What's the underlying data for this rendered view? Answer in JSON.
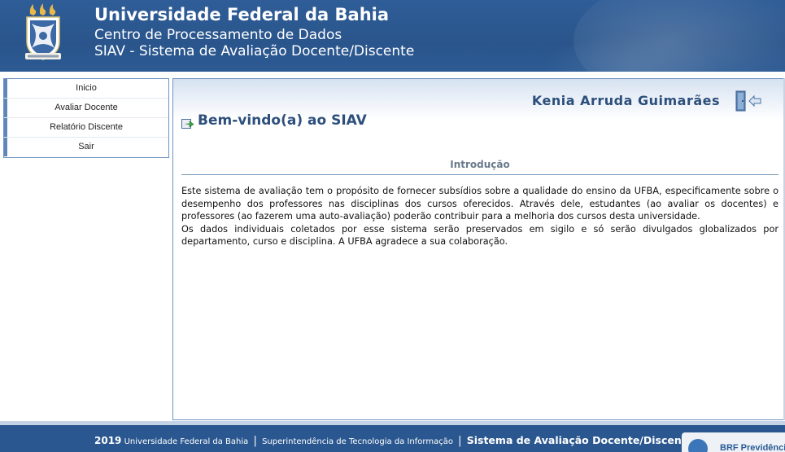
{
  "header": {
    "title": "Universidade Federal da Bahia",
    "subtitle": "Centro de Processamento de Dados",
    "system": "SIAV - Sistema de Avaliação Docente/Discente"
  },
  "menu": {
    "items": [
      {
        "label": "Inicio"
      },
      {
        "label": "Avaliar Docente"
      },
      {
        "label": "Relatório Discente"
      },
      {
        "label": "Sair"
      }
    ]
  },
  "main": {
    "user_name": "Kenia Arruda Guimarães",
    "welcome": "Bem-vindo(a) ao SIAV",
    "section_title": "Introdução",
    "paragraph1": "Este sistema de avaliação tem o propósito de fornecer subsídios sobre a qualidade do ensino da UFBA, especificamente sobre o desempenho dos professores nas disciplinas dos cursos oferecidos. Através dele, estudantes (ao avaliar os docentes) e professores (ao fazerem uma auto-avaliação) poderão contribuir para a melhoria dos cursos desta universidade.",
    "paragraph2": "Os dados individuais coletados por esse sistema serão preservados em sigilo e só serão divulgados globalizados por departamento, curso e disciplina. A UFBA agradece a sua colaboração."
  },
  "footer": {
    "year": "2019",
    "university": "Universidade Federal da Bahia",
    "separator": "|",
    "sti": "Superintendência de Tecnologia da Informação",
    "system": "Sistema de Avaliação Docente/Discente"
  },
  "ad": {
    "text": "BRF Previdência"
  },
  "colors": {
    "header_bg": "#2a558c",
    "accent": "#2c4f7c",
    "menu_border": "#6f93bf"
  },
  "icons": {
    "logo": "ufba-coat-of-arms",
    "exit": "exit-door-icon",
    "welcome": "arrow-page-icon"
  }
}
